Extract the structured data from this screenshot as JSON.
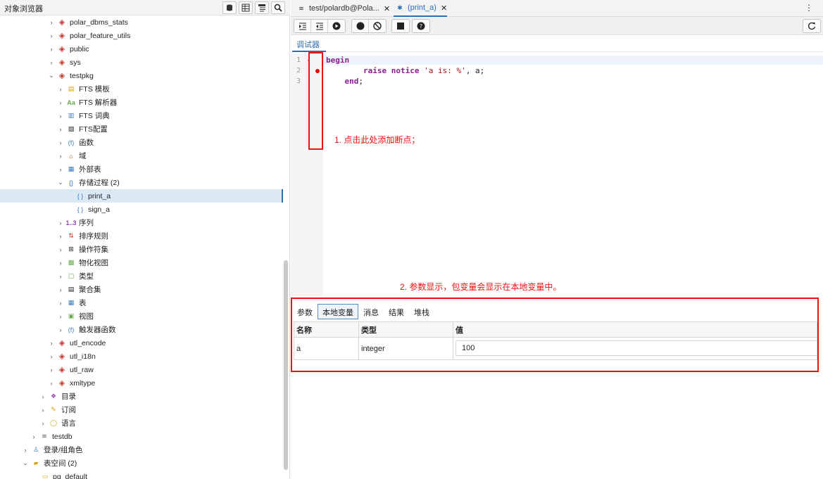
{
  "left_panel": {
    "title": "对象浏览器",
    "tree": [
      {
        "label": "polar_dbms_stats",
        "indent": 3,
        "icon": "schema-icon",
        "expanded": false
      },
      {
        "label": "polar_feature_utils",
        "indent": 3,
        "icon": "schema-icon",
        "expanded": false
      },
      {
        "label": "public",
        "indent": 3,
        "icon": "schema-icon",
        "expanded": false
      },
      {
        "label": "sys",
        "indent": 3,
        "icon": "schema-icon",
        "expanded": false
      },
      {
        "label": "testpkg",
        "indent": 3,
        "icon": "schema-icon",
        "expanded": true
      },
      {
        "label": "FTS 模板",
        "indent": 4,
        "icon": "fts-template-icon",
        "expanded": false
      },
      {
        "label": "FTS 解析器",
        "indent": 4,
        "icon": "fts-parser-icon",
        "expanded": false
      },
      {
        "label": "FTS 词典",
        "indent": 4,
        "icon": "fts-dictionary-icon",
        "expanded": false
      },
      {
        "label": "FTS配置",
        "indent": 4,
        "icon": "fts-config-icon",
        "expanded": false
      },
      {
        "label": "函数",
        "indent": 4,
        "icon": "function-icon",
        "expanded": false
      },
      {
        "label": "域",
        "indent": 4,
        "icon": "domain-icon",
        "expanded": false
      },
      {
        "label": "外部表",
        "indent": 4,
        "icon": "foreign-table-icon",
        "expanded": false
      },
      {
        "label": "存储过程 (2)",
        "indent": 4,
        "icon": "procedure-icon",
        "expanded": true
      },
      {
        "label": "print_a",
        "indent": 5,
        "icon": "procedure-item-icon",
        "selected": true
      },
      {
        "label": "sign_a",
        "indent": 5,
        "icon": "procedure-item-icon"
      },
      {
        "label": "序列",
        "indent": 4,
        "icon": "sequence-icon",
        "expanded": false
      },
      {
        "label": "排序规则",
        "indent": 4,
        "icon": "collation-icon",
        "expanded": false
      },
      {
        "label": "操作符集",
        "indent": 4,
        "icon": "operator-icon",
        "expanded": false
      },
      {
        "label": "物化视图",
        "indent": 4,
        "icon": "mview-icon",
        "expanded": false
      },
      {
        "label": "类型",
        "indent": 4,
        "icon": "type-icon",
        "expanded": false
      },
      {
        "label": "聚合集",
        "indent": 4,
        "icon": "aggregate-icon",
        "expanded": false
      },
      {
        "label": "表",
        "indent": 4,
        "icon": "table-icon",
        "expanded": false
      },
      {
        "label": "视图",
        "indent": 4,
        "icon": "view-icon",
        "expanded": false
      },
      {
        "label": "触发器函数",
        "indent": 4,
        "icon": "trigger-function-icon",
        "expanded": false
      },
      {
        "label": "utl_encode",
        "indent": 3,
        "icon": "schema-icon",
        "expanded": false
      },
      {
        "label": "utl_i18n",
        "indent": 3,
        "icon": "schema-icon",
        "expanded": false
      },
      {
        "label": "utl_raw",
        "indent": 3,
        "icon": "schema-icon",
        "expanded": false
      },
      {
        "label": "xmltype",
        "indent": 3,
        "icon": "schema-icon",
        "expanded": false
      },
      {
        "label": "目录",
        "indent": 2,
        "icon": "catalog-icon",
        "expanded": false
      },
      {
        "label": "订阅",
        "indent": 2,
        "icon": "subscription-icon",
        "expanded": false
      },
      {
        "label": "语言",
        "indent": 2,
        "icon": "language-icon",
        "expanded": false
      },
      {
        "label": "testdb",
        "indent": 1,
        "icon": "database-icon",
        "expanded": false
      },
      {
        "label": "登录/组角色",
        "indent": 0,
        "icon": "roles-icon",
        "expanded": false
      },
      {
        "label": "表空间 (2)",
        "indent": 0,
        "icon": "tablespace-icon",
        "expanded": true
      },
      {
        "label": "pg_default",
        "indent": 1,
        "icon": "folder-icon"
      }
    ]
  },
  "tabs": [
    {
      "label": "test/polardb@Pola...",
      "icon": "database-icon",
      "close": "✕"
    },
    {
      "label": "(print_a)",
      "icon": "debug-icon",
      "close": "✕",
      "active": true
    }
  ],
  "subtab": "调试器",
  "code": {
    "line_numbers": [
      "1",
      "2",
      "3"
    ],
    "lines": [
      {
        "kw1": "begin",
        "rest": ""
      },
      {
        "indent": "        ",
        "kw1": "raise",
        "sp": " ",
        "kw2": "notice",
        "sp2": " ",
        "str": "'a is: %'",
        "rest": ", a;"
      },
      {
        "indent": "    ",
        "kw1": "end",
        "rest": ";"
      }
    ]
  },
  "annotations": {
    "a1": "1. 点击此处添加断点；",
    "a2": "2. 参数显示，包变量会显示在本地变量中。"
  },
  "bottom_tabs": [
    "参数",
    "本地变量",
    "消息",
    "结果",
    "堆栈"
  ],
  "grid": {
    "headers": [
      "名称",
      "类型",
      "值"
    ],
    "rows": [
      [
        "a",
        "integer",
        "100"
      ]
    ]
  }
}
